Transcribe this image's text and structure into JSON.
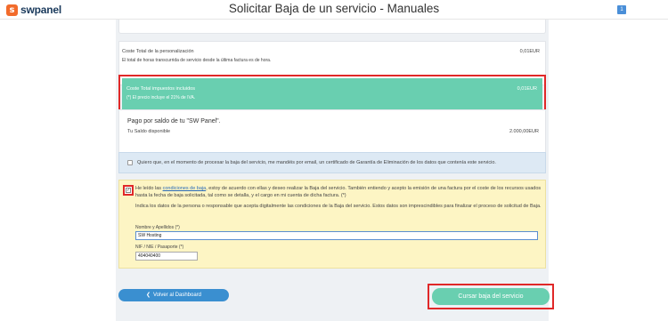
{
  "header": {
    "logo_mark": "s",
    "logo_text": "swpanel",
    "title": "Solicitar Baja de un servicio - Manuales",
    "user_badge": "1"
  },
  "personalizacion": {
    "title": "Coste Total de la personalización",
    "subtitle": "El total de horas transcurrida de servicio desde la última factura es de hora.",
    "amount": "0,01EUR"
  },
  "total": {
    "title": "Coste Total impuestos incluidos",
    "subtitle": "(*) El precio incluye el 21% de IVA.",
    "amount": "0,01EUR"
  },
  "saldo": {
    "title": "Pago por saldo de tu \"SW Panel\".",
    "subtitle": "Tu Saldo disponible",
    "amount": "2.000,00EUR"
  },
  "certificado": {
    "text": "Quiero que, en el momento de procesar la baja del servicio, me mandéis por email, un certificado de Garantía de Eliminación de los datos que contenía este servicio.",
    "checked": false
  },
  "terms": {
    "checked": true,
    "check_glyph": "✓",
    "text_before": "He leído las ",
    "link": "condiciones de baja",
    "text_after": ", estoy de acuerdo con ellas y deseo realizar la Baja del servicio. También entiendo y acepto la emisión de una factura por el coste de los recursos usados hasta la fecha de baja solicitada, tal como se detalla, y el cargo en mi cuenta de dicha factura. (*)",
    "hint": "Indica los datos de la persona o responsable que acepta digitalmente las condiciones de la Baja del servicio. Estos datos son imprescindibles para finalizar el proceso de solicitud de Baja.",
    "name_label": "Nombre y Apellidos (*)",
    "name_value": "SW Hosting",
    "nif_label": "NIF / NIE / Pasaporte (*)",
    "nif_value": "404040400"
  },
  "actions": {
    "back_chevron": "❮",
    "back_label": "Volver al Dashboard",
    "submit_label": "Cursar baja del servicio"
  },
  "colors": {
    "accent_green": "#69cfb0",
    "accent_blue": "#3a8fd0",
    "highlight_red": "#e02828",
    "brand_orange": "#f26b2b"
  }
}
